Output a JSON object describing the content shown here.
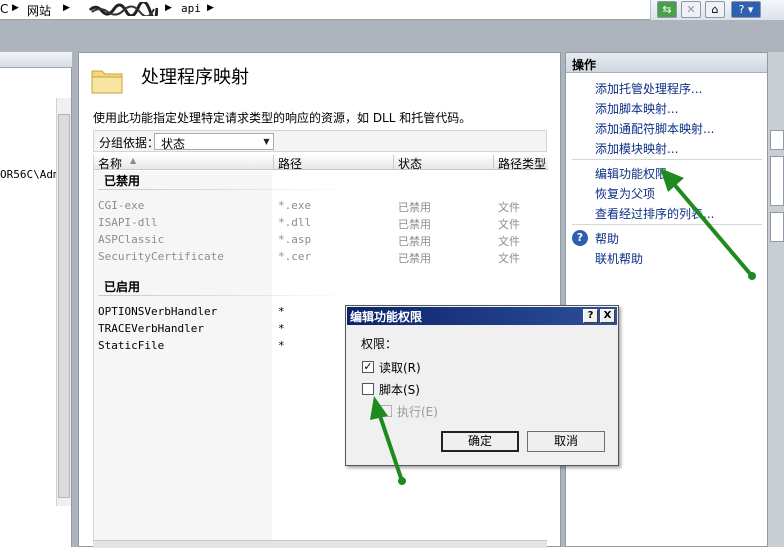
{
  "breadcrumb": {
    "items": [
      "C",
      "网站",
      "api"
    ],
    "obscured_segment": "scribbled-out site name"
  },
  "toolbar": {
    "icons": [
      "refresh-icon",
      "stop-icon",
      "home-icon",
      "help-icon"
    ]
  },
  "tree": {
    "node_label": "OR56C\\Adm"
  },
  "feature": {
    "title": "处理程序映射",
    "description": "使用此功能指定处理特定请求类型的响应的资源，如 DLL 和托管代码。",
    "groupby_label": "分组依据：",
    "groupby_value": "状态",
    "columns": [
      "名称",
      "路径",
      "状态",
      "路径类型"
    ],
    "groups": [
      {
        "name": "已禁用",
        "rows": [
          {
            "name": "CGI-exe",
            "path": "*.exe",
            "state": "已禁用",
            "type": "文件"
          },
          {
            "name": "ISAPI-dll",
            "path": "*.dll",
            "state": "已禁用",
            "type": "文件"
          },
          {
            "name": "ASPClassic",
            "path": "*.asp",
            "state": "已禁用",
            "type": "文件"
          },
          {
            "name": "SecurityCertificate",
            "path": "*.cer",
            "state": "已禁用",
            "type": "文件"
          }
        ]
      },
      {
        "name": "已启用",
        "rows": [
          {
            "name": "OPTIONSVerbHandler",
            "path": "*",
            "state": "",
            "type": ""
          },
          {
            "name": "TRACEVerbHandler",
            "path": "*",
            "state": "",
            "type": ""
          },
          {
            "name": "StaticFile",
            "path": "*",
            "state": "",
            "type": ""
          }
        ]
      }
    ]
  },
  "actions": {
    "title": "操作",
    "items": [
      "添加托管处理程序...",
      "添加脚本映射...",
      "添加通配符脚本映射...",
      "添加模块映射...",
      "编辑功能权限...",
      "恢复为父项",
      "查看经过排序的列表..."
    ],
    "help": "帮助",
    "online_help": "联机帮助"
  },
  "dialog": {
    "title": "编辑功能权限",
    "help_btn": "?",
    "close_btn": "X",
    "section_label": "权限：",
    "read_label": "读取(R)",
    "read_checked": true,
    "script_label": "脚本(S)",
    "script_checked": false,
    "execute_label": "执行(E)",
    "execute_checked": false,
    "execute_enabled": false,
    "ok_label": "确定",
    "cancel_label": "取消"
  },
  "colors": {
    "arrow_green": "#1f8a1f",
    "link_blue": "#0b2f86",
    "dialog_title": "#0a246a"
  }
}
